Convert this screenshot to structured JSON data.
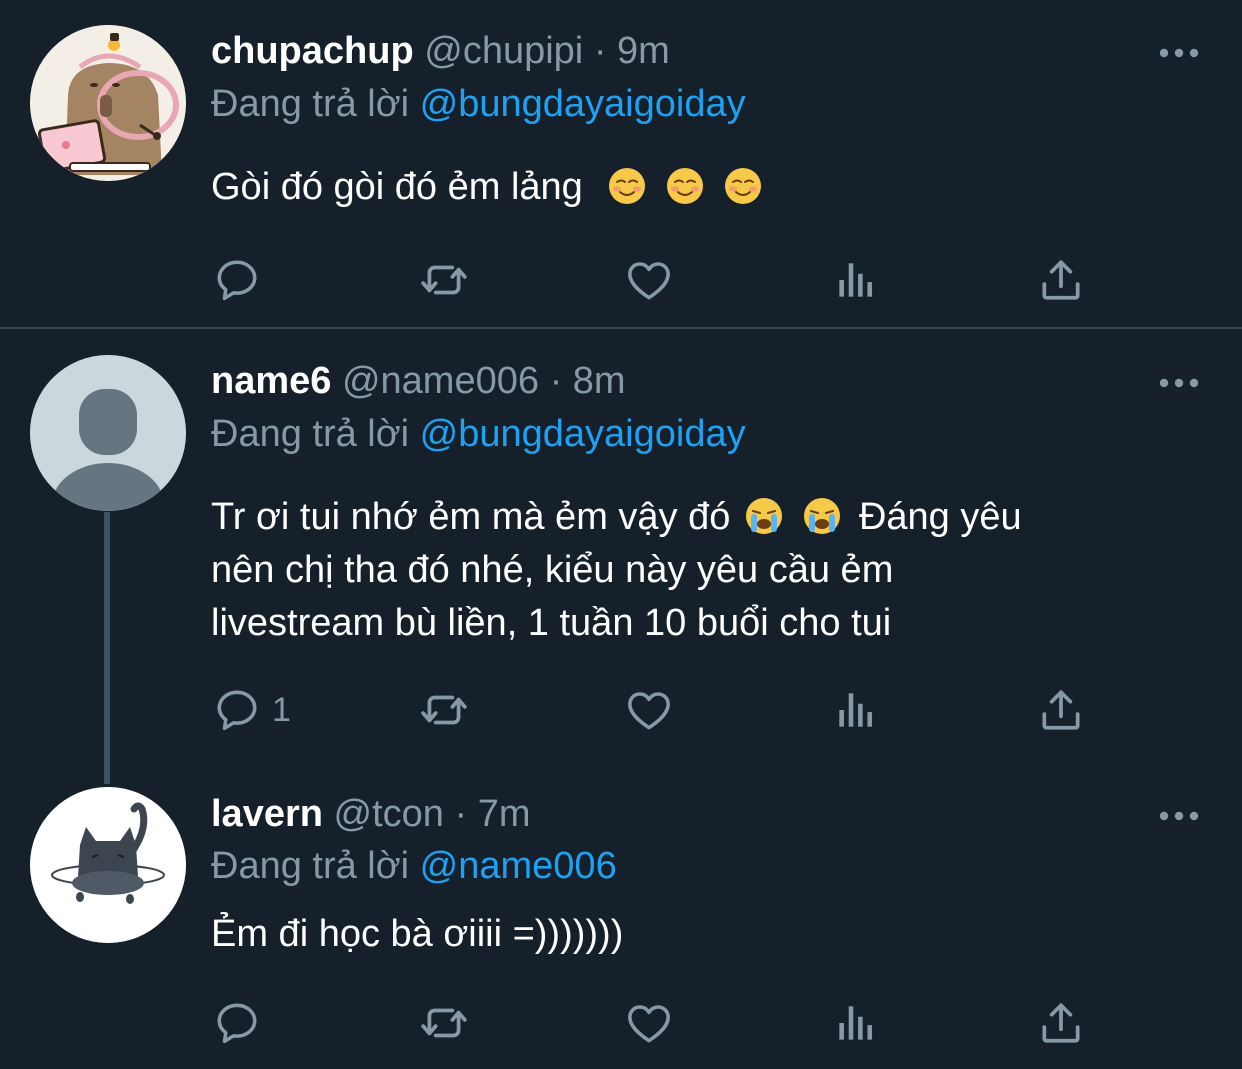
{
  "tweets": [
    {
      "display_name": "chupachup",
      "handle": "@chupipi",
      "separator": "·",
      "time": "9m",
      "replying_prefix": "Đang trả lời",
      "replying_to": "@bungdayaigoiday",
      "text": "Gòi đó gòi đó ẻm lảng",
      "emojis": [
        "smiling-face",
        "smiling-face",
        "smiling-face"
      ],
      "reply_count": ""
    },
    {
      "display_name": "name6",
      "handle": "@name006",
      "separator": "·",
      "time": "8m",
      "replying_prefix": "Đang trả lời",
      "replying_to": "@bungdayaigoiday",
      "text_line1_start": "Tr ơi tui nhớ ẻm mà ẻm vậy đó",
      "text_line1_end": "Đáng yêu",
      "text_line2": "nên chị tha đó nhé, kiểu này yêu cầu ẻm",
      "text_line3": "livestream bù liền, 1 tuần 10 buổi cho tui",
      "emojis": [
        "crying-face",
        "crying-face"
      ],
      "reply_count": "1"
    },
    {
      "display_name": "lavern",
      "handle": "@tcon",
      "separator": "·",
      "time": "7m",
      "replying_prefix": "Đang trả lời",
      "replying_to": "@name006",
      "text": "Ẻm đi học bà ơiiii =)))))))",
      "reply_count": ""
    }
  ],
  "colors": {
    "background": "#15202b",
    "secondary_text": "#8899a6",
    "link": "#1da1f2",
    "divider": "#38444d",
    "thread_line": "#3d5466"
  },
  "icons": [
    "reply-icon",
    "retweet-icon",
    "like-icon",
    "analytics-icon",
    "share-icon",
    "more-icon"
  ]
}
